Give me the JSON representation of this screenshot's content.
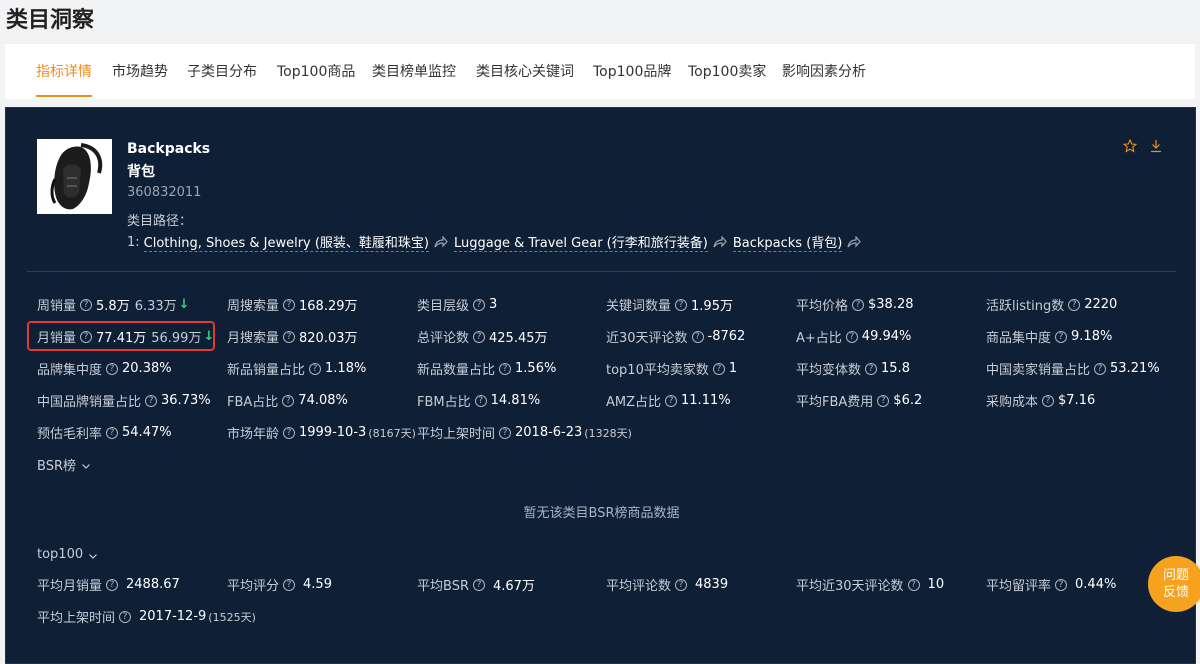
{
  "page": {
    "title": "类目洞察"
  },
  "tabs": [
    {
      "label": "指标详情"
    },
    {
      "label": "市场趋势"
    },
    {
      "label": "子类目分布"
    },
    {
      "label": "Top100商品"
    },
    {
      "label": "类目榜单监控"
    },
    {
      "label": "类目核心关键词"
    },
    {
      "label": "Top100品牌"
    },
    {
      "label": "Top100卖家"
    },
    {
      "label": "影响因素分析"
    }
  ],
  "category": {
    "name_en": "Backpacks",
    "name_zh": "背包",
    "id": "360832011",
    "path_label": "类目路径：",
    "path_index": "1:",
    "path": [
      {
        "label": "Clothing, Shoes & Jewelry (服装、鞋履和珠宝)"
      },
      {
        "label": "Luggage & Travel Gear (行李和旅行装备)"
      },
      {
        "label": "Backpacks (背包)"
      }
    ]
  },
  "metrics": {
    "weekly_sales": {
      "label": "周销量",
      "value": "5.8万",
      "prev": "6.33万"
    },
    "weekly_search": {
      "label": "周搜索量",
      "value": "168.29万"
    },
    "category_level": {
      "label": "类目层级",
      "value": "3"
    },
    "keyword_count": {
      "label": "关键词数量",
      "value": "1.95万"
    },
    "avg_price": {
      "label": "平均价格",
      "value": "$38.28"
    },
    "active_listing": {
      "label": "活跃listing数",
      "value": "2220"
    },
    "monthly_sales": {
      "label": "月销量",
      "value": "77.41万",
      "prev": "56.99万"
    },
    "monthly_search": {
      "label": "月搜索量",
      "value": "820.03万"
    },
    "total_reviews": {
      "label": "总评论数",
      "value": "425.45万"
    },
    "reviews_30d": {
      "label": "近30天评论数",
      "value": "-8762"
    },
    "aplus_ratio": {
      "label": "A+占比",
      "value": "49.94%"
    },
    "product_concentration": {
      "label": "商品集中度",
      "value": "9.18%"
    },
    "brand_concentration": {
      "label": "品牌集中度",
      "value": "20.38%"
    },
    "new_sales_ratio": {
      "label": "新品销量占比",
      "value": "1.18%"
    },
    "new_count_ratio": {
      "label": "新品数量占比",
      "value": "1.56%"
    },
    "top10_sellers": {
      "label": "top10平均卖家数",
      "value": "1"
    },
    "avg_variants": {
      "label": "平均变体数",
      "value": "15.8"
    },
    "cn_seller_sales_ratio": {
      "label": "中国卖家销量占比",
      "value": "53.21%"
    },
    "cn_brand_sales_ratio": {
      "label": "中国品牌销量占比",
      "value": "36.73%"
    },
    "fba_ratio": {
      "label": "FBA占比",
      "value": "74.08%"
    },
    "fbm_ratio": {
      "label": "FBM占比",
      "value": "14.81%"
    },
    "amz_ratio": {
      "label": "AMZ占比",
      "value": "11.11%"
    },
    "avg_fba_fee": {
      "label": "平均FBA费用",
      "value": "$6.2"
    },
    "purchase_cost": {
      "label": "采购成本",
      "value": "$7.16"
    },
    "gross_margin": {
      "label": "预估毛利率",
      "value": "54.47%"
    },
    "market_age": {
      "label": "市场年龄",
      "value": "1999-10-3",
      "note": "(8167天)"
    },
    "avg_listing_time": {
      "label": "平均上架时间",
      "value": "2018-6-23",
      "note": "(1328天)"
    }
  },
  "bsr": {
    "label": "BSR榜",
    "empty": "暂无该类目BSR榜商品数据"
  },
  "top100": {
    "label": "top100",
    "avg_monthly_sales": {
      "label": "平均月销量",
      "value": "2488.67"
    },
    "avg_rating": {
      "label": "平均评分",
      "value": "4.59"
    },
    "avg_bsr": {
      "label": "平均BSR",
      "value": "4.67万"
    },
    "avg_reviews": {
      "label": "平均评论数",
      "value": "4839"
    },
    "avg_reviews_30d": {
      "label": "平均近30天评论数",
      "value": "10"
    },
    "avg_retention": {
      "label": "平均留评率",
      "value": "0.44%"
    },
    "avg_listing_time": {
      "label": "平均上架时间",
      "value": "2017-12-9",
      "note": "(1525天)"
    }
  },
  "feedback": {
    "line1": "问题",
    "line2": "反馈"
  },
  "colors": {
    "accent": "#f08c1e",
    "panel_bg": "#0f2036",
    "down": "#2fd27a",
    "highlight": "#e53935"
  }
}
